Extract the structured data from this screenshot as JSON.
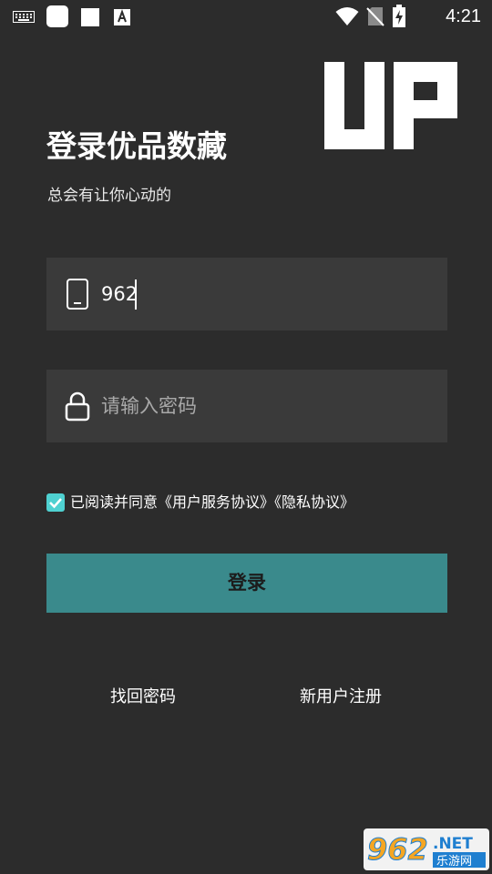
{
  "status_bar": {
    "time": "4:21",
    "icons": [
      "keyboard-icon",
      "square-notification-icon",
      "square-notification-icon",
      "text-a-icon",
      "wifi-icon",
      "no-sim-icon",
      "battery-charging-icon"
    ]
  },
  "logo": {
    "text": "UP"
  },
  "header": {
    "title": "登录优品数藏",
    "subtitle": "总会有让你心动的"
  },
  "phone_field": {
    "value": "962",
    "icon": "phone-icon"
  },
  "password_field": {
    "placeholder": "请输入密码",
    "icon": "lock-icon"
  },
  "agreement": {
    "checked": true,
    "text": "已阅读并同意《用户服务协议》《隐私协议》"
  },
  "login_button": {
    "label": "登录"
  },
  "links": {
    "forgot_password": "找回密码",
    "register": "新用户注册"
  },
  "watermark": {
    "number": "962",
    "suffix": ".NET",
    "caption": "乐游网"
  },
  "colors": {
    "background": "#2c2c2c",
    "field_background": "#3a3a3a",
    "accent": "#3a8a8c",
    "checkbox": "#4fd1d1"
  }
}
